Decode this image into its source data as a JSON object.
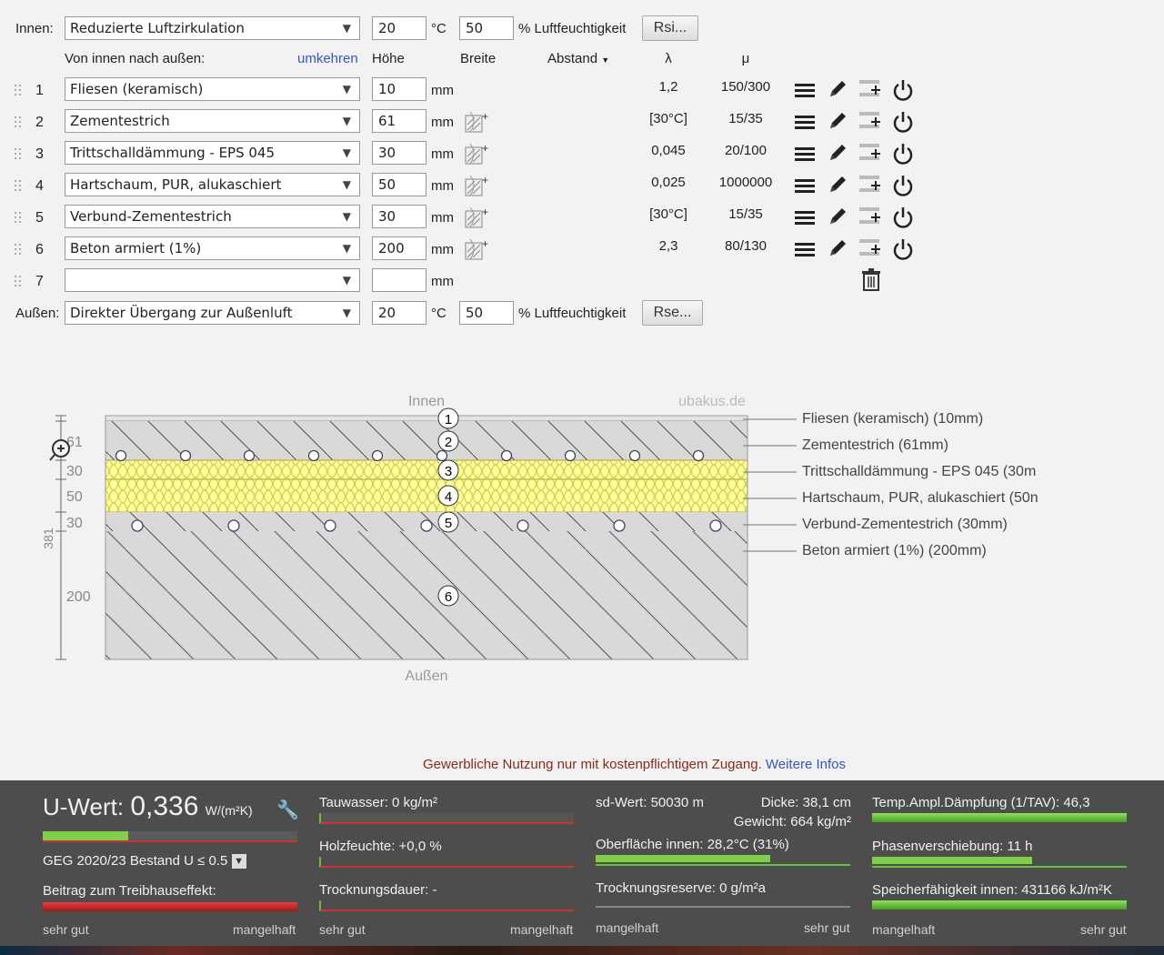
{
  "inner": {
    "label": "Innen:",
    "select": "Reduzierte Luftzirkulation",
    "temp": "20",
    "temp_unit": "°C",
    "humidity": "50",
    "humidity_label": "% Luftfeuchtigkeit",
    "button": "Rsi..."
  },
  "header": {
    "direction": "Von innen nach außen:",
    "reverse": "umkehren",
    "height": "Höhe",
    "width": "Breite",
    "distance": "Abstand",
    "lambda": "λ",
    "mu": "μ"
  },
  "layers": [
    {
      "no": "1",
      "material": "Fliesen (keramisch)",
      "thickness": "10",
      "unit": "mm",
      "lambda": "1,2",
      "mu": "150/300"
    },
    {
      "no": "2",
      "material": "Zementestrich",
      "thickness": "61",
      "unit": "mm",
      "lambda": "[30°C]",
      "mu": "15/35"
    },
    {
      "no": "3",
      "material": "Trittschalldämmung - EPS 045",
      "thickness": "30",
      "unit": "mm",
      "lambda": "0,045",
      "mu": "20/100"
    },
    {
      "no": "4",
      "material": "Hartschaum, PUR, alukaschiert",
      "thickness": "50",
      "unit": "mm",
      "lambda": "0,025",
      "mu": "1000000"
    },
    {
      "no": "5",
      "material": "Verbund-Zementestrich",
      "thickness": "30",
      "unit": "mm",
      "lambda": "[30°C]",
      "mu": "15/35"
    },
    {
      "no": "6",
      "material": "Beton armiert (1%)",
      "thickness": "200",
      "unit": "mm",
      "lambda": "2,3",
      "mu": "80/130"
    },
    {
      "no": "7",
      "material": "",
      "thickness": "",
      "unit": "mm",
      "lambda": "",
      "mu": ""
    }
  ],
  "outer": {
    "label": "Außen:",
    "select": "Direkter Übergang zur Außenluft",
    "temp": "20",
    "temp_unit": "°C",
    "humidity": "50",
    "humidity_label": "% Luftfeuchtigkeit",
    "button": "Rse..."
  },
  "diagram": {
    "top_label": "Innen",
    "bottom_label": "Außen",
    "watermark": "ubakus.de",
    "total": "381",
    "dims": [
      "61",
      "30",
      "50",
      "30",
      "200"
    ],
    "legend": [
      "Fliesen (keramisch) (10mm)",
      "Zementestrich (61mm)",
      "Trittschalldämmung - EPS 045 (30m",
      "Hartschaum, PUR, alukaschiert (50n",
      "Verbund-Zementestrich (30mm)",
      "Beton armiert (1%) (200mm)"
    ]
  },
  "notice": {
    "text": "Gewerbliche Nutzung nur mit kostenpflichtigem Zugang.",
    "link": "Weitere Infos"
  },
  "results": {
    "uwert_label": "U-Wert:",
    "uwert_value": "0,336",
    "uwert_unit": "W/(m²K)",
    "geg": "GEG 2020/23 Bestand U ≤ 0.5",
    "treibhaus": "Beitrag zum Treibhauseffekt:",
    "tauwasser": "Tauwasser: 0 kg/m²",
    "holzfeuchte": "Holzfeuchte: +0,0 %",
    "trocknung": "Trocknungsdauer: -",
    "sdwert": "sd-Wert: 50030 m",
    "dicke": "Dicke: 38,1 cm",
    "gewicht": "Gewicht: 664 kg/m²",
    "oberflaeche": "Oberfläche innen: 28,2°C (31%)",
    "reserve": "Trocknungsreserve: 0 g/m²a",
    "tav": "Temp.Ampl.Dämpfung (1/TAV): 46,3",
    "phase": "Phasenverschiebung: 11 h",
    "speicher": "Speicherfähigkeit innen: 431166 kJ/m²K",
    "scale_good": "sehr gut",
    "scale_bad": "mangelhaft"
  },
  "colors": {
    "insulation": "#ffff99",
    "concrete": "#d9d9d9",
    "footer": "#4d4d4d",
    "bar_green": "#6abf3c",
    "bar_red": "#d33"
  }
}
